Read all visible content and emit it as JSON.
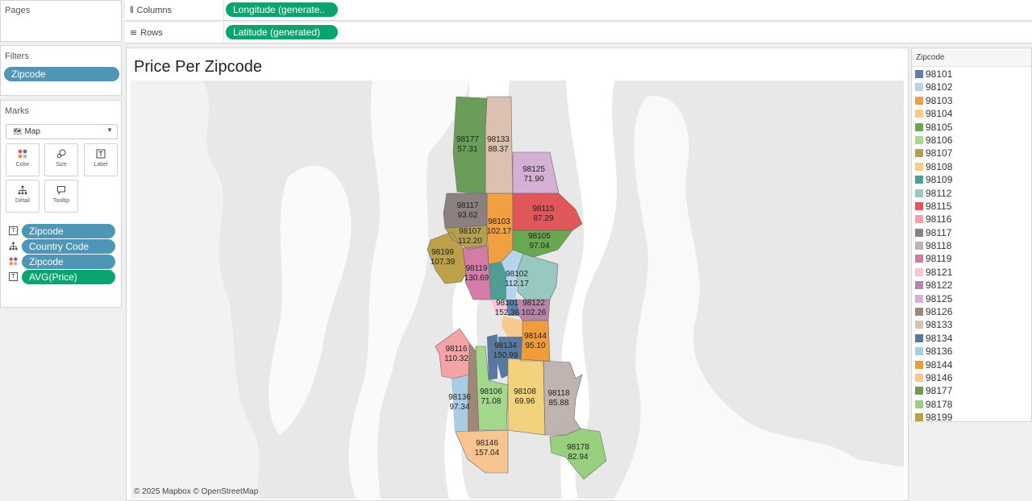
{
  "left": {
    "pages_title": "Pages",
    "filters_title": "Filters",
    "filter_pill": "Zipcode",
    "marks_title": "Marks",
    "mark_type": "Map",
    "mark_type_icon": "map-icon",
    "buttons": {
      "color": "Color",
      "size": "Size",
      "label": "Label",
      "detail": "Detail",
      "tooltip": "Tooltip"
    },
    "encodings": [
      {
        "field": "Zipcode",
        "icon": "label-icon",
        "pill_color": "blue"
      },
      {
        "field": "Country Code",
        "icon": "detail-icon",
        "pill_color": "blue"
      },
      {
        "field": "Zipcode",
        "icon": "color-icon",
        "pill_color": "blue"
      },
      {
        "field": "AVG(Price)",
        "icon": "label-icon",
        "pill_color": "green"
      }
    ]
  },
  "shelves": {
    "columns_label": "Columns",
    "columns_pill": "Longitude (generate..",
    "rows_label": "Rows",
    "rows_pill": "Latitude (generated)"
  },
  "view": {
    "title": "Price Per Zipcode",
    "attribution": "© 2025 Mapbox © OpenStreetMap"
  },
  "legend": {
    "title": "Zipcode",
    "items": [
      {
        "zip": "98101",
        "color": "#5b7fa8"
      },
      {
        "zip": "98102",
        "color": "#b6d4ea"
      },
      {
        "zip": "98103",
        "color": "#f0a043"
      },
      {
        "zip": "98104",
        "color": "#f8c88c"
      },
      {
        "zip": "98105",
        "color": "#6aa84f"
      },
      {
        "zip": "98106",
        "color": "#a4d88c"
      },
      {
        "zip": "98107",
        "color": "#b4a04f"
      },
      {
        "zip": "98108",
        "color": "#f2d27c"
      },
      {
        "zip": "98109",
        "color": "#4e9e96"
      },
      {
        "zip": "98112",
        "color": "#98c8c0"
      },
      {
        "zip": "98115",
        "color": "#e15759"
      },
      {
        "zip": "98116",
        "color": "#f6a3a8"
      },
      {
        "zip": "98117",
        "color": "#8c8080"
      },
      {
        "zip": "98118",
        "color": "#c0b4b0"
      },
      {
        "zip": "98119",
        "color": "#d47ca8"
      },
      {
        "zip": "98121",
        "color": "#f6c6d6"
      },
      {
        "zip": "98122",
        "color": "#b884a8"
      },
      {
        "zip": "98125",
        "color": "#d4b0d4"
      },
      {
        "zip": "98126",
        "color": "#a08878"
      },
      {
        "zip": "98133",
        "color": "#dcc0b0"
      },
      {
        "zip": "98134",
        "color": "#5878a0"
      },
      {
        "zip": "98136",
        "color": "#a8cce4"
      },
      {
        "zip": "98144",
        "color": "#f09c3c"
      },
      {
        "zip": "98146",
        "color": "#f8c490"
      },
      {
        "zip": "98177",
        "color": "#6a9e58"
      },
      {
        "zip": "98178",
        "color": "#98d080"
      },
      {
        "zip": "98199",
        "color": "#bca04a"
      }
    ]
  },
  "regions": [
    {
      "zip": "98177",
      "value": "57.31"
    },
    {
      "zip": "98133",
      "value": "88.37"
    },
    {
      "zip": "98125",
      "value": "71.90"
    },
    {
      "zip": "98117",
      "value": "93.62"
    },
    {
      "zip": "98103",
      "value": "102.17"
    },
    {
      "zip": "98115",
      "value": "87.29"
    },
    {
      "zip": "98107",
      "value": "112.20"
    },
    {
      "zip": "98105",
      "value": "97.04"
    },
    {
      "zip": "98199",
      "value": "107.39"
    },
    {
      "zip": "98119",
      "value": "130.69"
    },
    {
      "zip": "98102",
      "value": "112.17"
    },
    {
      "zip": "98101",
      "value": "152.36"
    },
    {
      "zip": "98122",
      "value": "102.26"
    },
    {
      "zip": "98144",
      "value": "95.10"
    },
    {
      "zip": "98134",
      "value": "150.99"
    },
    {
      "zip": "98116",
      "value": "110.32"
    },
    {
      "zip": "98136",
      "value": "97.34"
    },
    {
      "zip": "98106",
      "value": "71.08"
    },
    {
      "zip": "98108",
      "value": "69.96"
    },
    {
      "zip": "98118",
      "value": "85.88"
    },
    {
      "zip": "98146",
      "value": "157.04"
    },
    {
      "zip": "98178",
      "value": "82.94"
    }
  ]
}
